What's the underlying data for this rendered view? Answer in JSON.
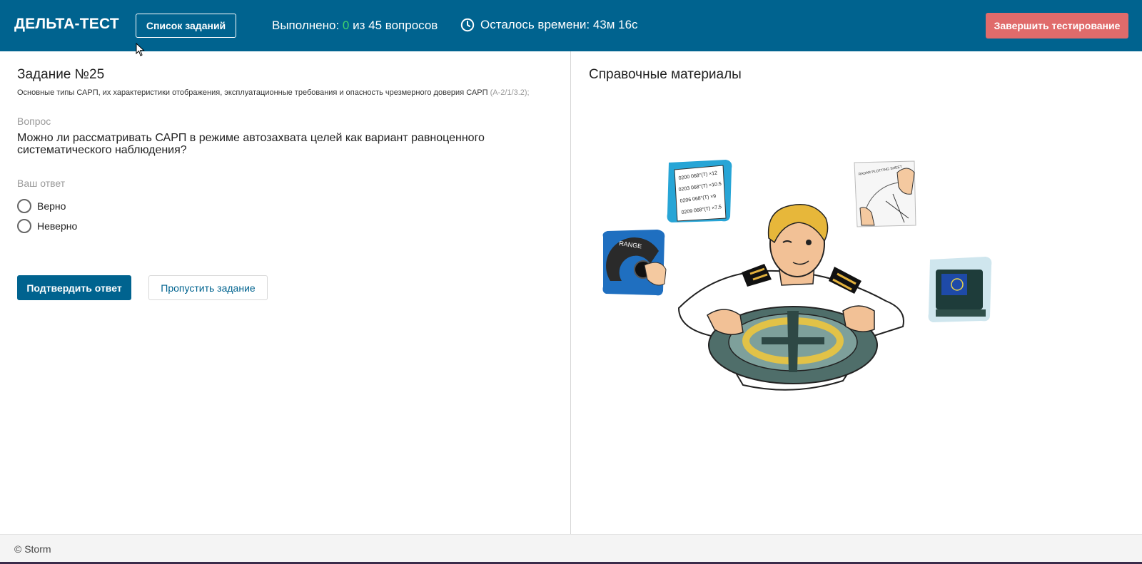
{
  "header": {
    "brand": "ДЕЛЬТА-ТЕСТ",
    "tasks_button": "Список заданий",
    "progress_prefix": "Выполнено: ",
    "progress_done": "0",
    "progress_suffix": " из 45 вопросов",
    "timer_icon": "clock-icon",
    "timer_text": "Осталось времени: 43м 16с",
    "finish_button": "Завершить тестирование"
  },
  "task": {
    "title": "Задание №25",
    "topic": "Основные типы САРП, их характеристики отображения, эксплуатационные требования и опасность чрезмерного доверия САРП",
    "topic_code": "(А-2/1/3.2);",
    "question_label": "Вопрос",
    "question_text": "Можно ли рассматривать САРП в режиме автозахвата целей как вариант равноценного систематического наблюдения?",
    "answer_label": "Ваш ответ",
    "options": [
      "Верно",
      "Неверно"
    ],
    "confirm_button": "Подтвердить ответ",
    "skip_button": "Пропустить задание"
  },
  "reference": {
    "title": "Справочные материалы",
    "illustration_labels": {
      "range": "RANGE",
      "sheet": "RADAR PLOTTING SHEET",
      "note1": "0200 068°(T) ×12",
      "note2": "0203 068°(T) ×10.5",
      "note3": "0206 068°(T) ×9",
      "note4": "0209 068°(T) ×7.5"
    }
  },
  "footer": {
    "copyright": "© Storm"
  },
  "colors": {
    "header_bg": "#00638f",
    "finish_bg": "#e06b6b",
    "done_green": "#3fd46b"
  }
}
